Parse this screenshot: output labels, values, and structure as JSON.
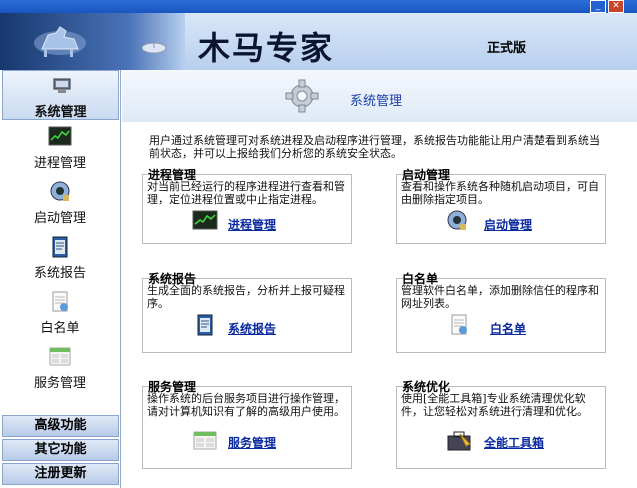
{
  "window": {
    "minimize_icon": "minimize-icon",
    "close_icon": "close-icon"
  },
  "banner": {
    "title": "木马专家",
    "edition": "正式版"
  },
  "sidebar": {
    "header": "系统管理",
    "items": [
      {
        "label": "进程管理",
        "icon": "process-monitor-icon"
      },
      {
        "label": "启动管理",
        "icon": "startup-icon"
      },
      {
        "label": "系统报告",
        "icon": "report-icon"
      },
      {
        "label": "白名单",
        "icon": "whitelist-icon"
      },
      {
        "label": "服务管理",
        "icon": "service-icon"
      }
    ],
    "buttons": [
      "高级功能",
      "其它功能",
      "注册更新"
    ]
  },
  "main": {
    "title": "系统管理",
    "intro": "用户通过系统管理可对系统进程及启动程序进行管理，系统报告功能能让用户清楚看到系统当前状态，并可以上报给我们分析您的系统安全状态。",
    "cards": [
      {
        "title": "进程管理",
        "desc": "对当前已经运行的程序进程进行查看和管理，定位进程位置或中止指定进程。",
        "link": "进程管理"
      },
      {
        "title": "启动管理",
        "desc": "查看和操作系统各种随机启动项目，可自由删除指定项目。",
        "link": "启动管理"
      },
      {
        "title": "系统报告",
        "desc": "生成全面的系统报告，分析并上报可疑程序。",
        "link": "系统报告"
      },
      {
        "title": "白名单",
        "desc": "管理软件白名单，添加删除信任的程序和网址列表。",
        "link": "白名单"
      },
      {
        "title": "服务管理",
        "desc": "操作系统的后台服务项目进行操作管理，请对计算机知识有了解的高级用户使用。",
        "link": "服务管理"
      },
      {
        "title": "系统优化",
        "desc": "使用[全能工具箱]专业系统清理优化软件，让您轻松对系统进行清理和优化。",
        "link": "全能工具箱"
      }
    ]
  }
}
